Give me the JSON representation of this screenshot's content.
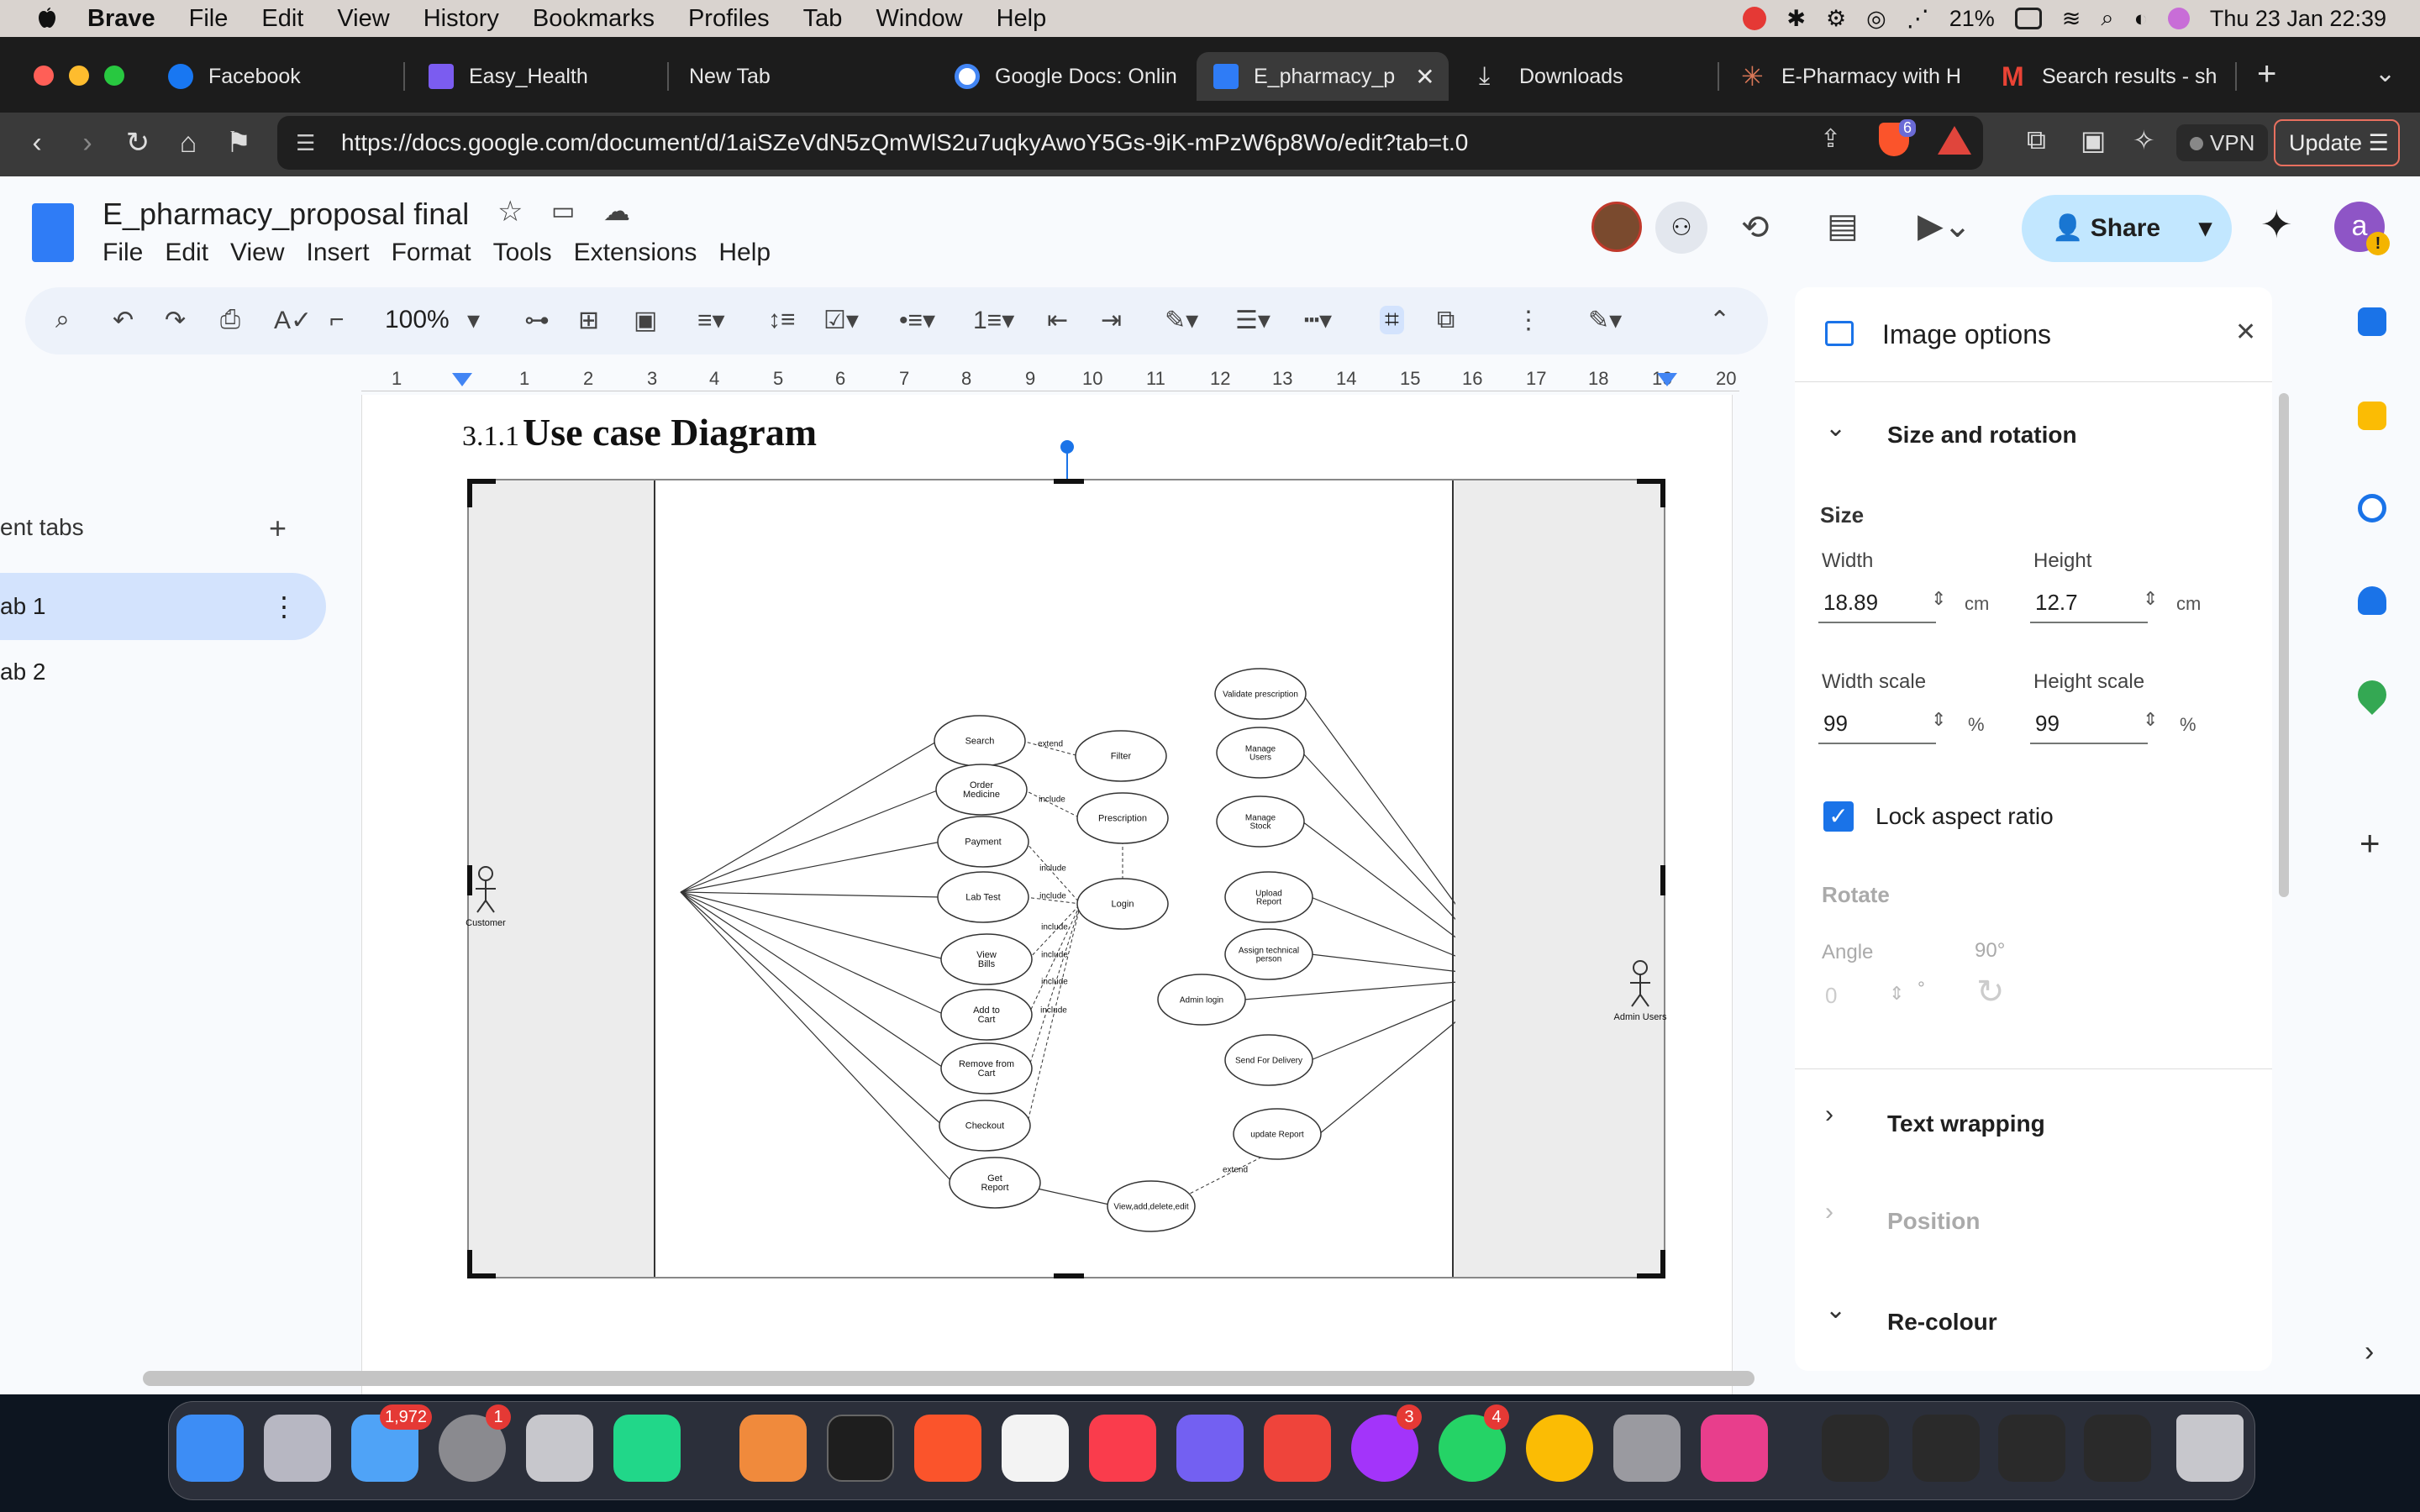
{
  "menubar": {
    "app": "Brave",
    "items": [
      "File",
      "Edit",
      "View",
      "History",
      "Bookmarks",
      "Profiles",
      "Tab",
      "Window",
      "Help"
    ],
    "battery": "21%",
    "datetime": "Thu 23 Jan  22:39"
  },
  "tabs": [
    {
      "label": "Facebook",
      "icon": "facebook-icon",
      "color": "#1877f2"
    },
    {
      "label": "Easy_Health",
      "icon": "vee-icon",
      "color": "#7b5cf0"
    },
    {
      "label": "New Tab",
      "icon": "",
      "color": "#1c1c1c"
    },
    {
      "label": "Google Docs: Onlin",
      "icon": "google-icon",
      "color": "#ffffff"
    },
    {
      "label": "E_pharmacy_p",
      "icon": "docs-icon",
      "color": "#2f7cf6"
    },
    {
      "label": "Downloads",
      "icon": "download-icon",
      "color": "#1c1c1c"
    },
    {
      "label": "E-Pharmacy with H",
      "icon": "claude-icon",
      "color": "#d97757"
    },
    {
      "label": "Search results - sh",
      "icon": "gmail-icon",
      "color": "#ea4335"
    }
  ],
  "url": "https://docs.google.com/document/d/1aiSZeVdN5zQmWlS2u7uqkyAwoY5Gs-9iK-mPzW6p8Wo/edit?tab=t.0",
  "vpn": "VPN",
  "update": "Update",
  "brave_badge": "6",
  "doc": {
    "title": "E_pharmacy_proposal final",
    "menu": [
      "File",
      "Edit",
      "View",
      "Insert",
      "Format",
      "Tools",
      "Extensions",
      "Help"
    ],
    "zoom": "100%",
    "share": "Share",
    "avatar": "a"
  },
  "ruler": [
    "1",
    "1",
    "2",
    "3",
    "4",
    "5",
    "6",
    "7",
    "8",
    "9",
    "10",
    "11",
    "12",
    "13",
    "14",
    "15",
    "16",
    "17",
    "18",
    "19",
    "20"
  ],
  "sidebar": {
    "title": "ent tabs",
    "tab1": "ab 1",
    "tab2": "ab 2"
  },
  "heading": {
    "number": "3.1.1",
    "title": "Use case Diagram"
  },
  "diagram": {
    "customer": "Customer",
    "admin": "Admin Users",
    "left": [
      "Search",
      "Order\nMedicine",
      "Payment",
      "Lab Test",
      "View\nBills",
      "Add to\nCart",
      "Remove from\nCart",
      "Checkout",
      "Get\nReport"
    ],
    "mid": [
      "Filter",
      "Prescription",
      "Login"
    ],
    "right": [
      "Validate prescription",
      "Manage\nUsers",
      "Manage\nStock",
      "Upload\nReport",
      "Assign technical\nperson",
      "Admin login",
      "Send For Delivery",
      "update Report",
      "View,add,delete,edit"
    ],
    "rel": [
      "extend",
      "include",
      "include",
      "include",
      "include",
      "include",
      "include",
      "include",
      "extend"
    ]
  },
  "panel": {
    "title": "Image options",
    "size_rotation": "Size and rotation",
    "size": "Size",
    "width_label": "Width",
    "width": "18.89",
    "height_label": "Height",
    "height": "12.7",
    "unit": "cm",
    "wscale_label": "Width scale",
    "wscale": "99",
    "hscale_label": "Height scale",
    "hscale": "99",
    "pct": "%",
    "lock": "Lock aspect ratio",
    "rotate": "Rotate",
    "angle_label": "Angle",
    "angle": "0",
    "deg": "°",
    "ninety": "90°",
    "text_wrapping": "Text wrapping",
    "position": "Position",
    "recolour": "Re-colour"
  },
  "dock": {
    "mail_badge": "1,972",
    "settings_badge": "1",
    "messenger_badge": "3",
    "whatsapp_badge": "4"
  }
}
